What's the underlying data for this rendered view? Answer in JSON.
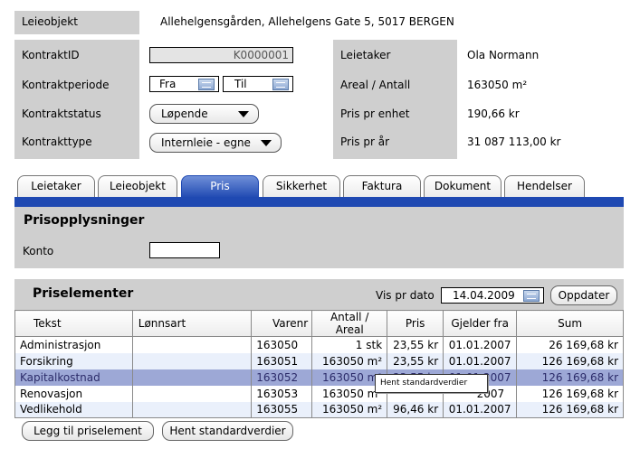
{
  "header": {
    "leieobjekt_label": "Leieobjekt",
    "leieobjekt_value": "Allehelgensgården, Allehelgens Gate 5, 5017 BERGEN"
  },
  "contract": {
    "kontraktid_label": "KontraktID",
    "kontraktid_value": "K0000001",
    "periode_label": "Kontraktperiode",
    "fra_label": "Fra",
    "til_label": "Til",
    "status_label": "Kontraktstatus",
    "status_value": "Løpende",
    "type_label": "Kontrakttype",
    "type_value": "Internleie - egne"
  },
  "summary": {
    "leietaker_label": "Leietaker",
    "leietaker_value": "Ola Normann",
    "areal_label": "Areal / Antall",
    "areal_value": "163050 m²",
    "pris_enhet_label": "Pris pr enhet",
    "pris_enhet_value": "190,66 kr",
    "pris_aar_label": "Pris pr år",
    "pris_aar_value": "31 087 113,00 kr"
  },
  "tabs": [
    {
      "label": "Leietaker"
    },
    {
      "label": "Leieobjekt"
    },
    {
      "label": "Pris",
      "active": true
    },
    {
      "label": "Sikkerhet"
    },
    {
      "label": "Faktura"
    },
    {
      "label": "Dokument"
    },
    {
      "label": "Hendelser"
    }
  ],
  "prisopplysninger": {
    "title": "Prisopplysninger",
    "konto_label": "Konto",
    "konto_value": ""
  },
  "priselementer": {
    "title": "Priselementer",
    "vis_pr_dato_label": "Vis pr dato",
    "vis_pr_dato_value": "14.04.2009",
    "oppdater_label": "Oppdater",
    "columns": [
      "Tekst",
      "Lønnsart",
      "Varenr",
      "Antall / Areal",
      "Pris",
      "Gjelder fra",
      "Sum"
    ],
    "rows": [
      [
        "Administrasjon",
        "",
        "163050",
        "1 stk",
        "23,55 kr",
        "01.01.2007",
        "26 169,68 kr"
      ],
      [
        "Forsikring",
        "",
        "163051",
        "163050 m²",
        "23,55 kr",
        "01.01.2007",
        "126 169,68 kr"
      ],
      [
        "Kapitalkostnad",
        "",
        "163052",
        "163050 m²",
        "23,55 kr",
        "01.01.2007",
        "126 169,68 kr"
      ],
      [
        "Renovasjon",
        "",
        "163053",
        "163050 m²",
        "",
        "2007",
        "126 169,68 kr"
      ],
      [
        "Vedlikehold",
        "",
        "163055",
        "163050 m²",
        "96,46 kr",
        "01.01.2007",
        "126 169,68 kr"
      ]
    ],
    "tooltip": "Hent standardverdier"
  },
  "buttons": {
    "legg_til": "Legg til priselement",
    "hent_standard": "Hent standardverdier"
  },
  "colors": {
    "accent": "#1f49b2",
    "panel_gray": "#cfcfcf",
    "selected_row": "#9da8d6"
  }
}
